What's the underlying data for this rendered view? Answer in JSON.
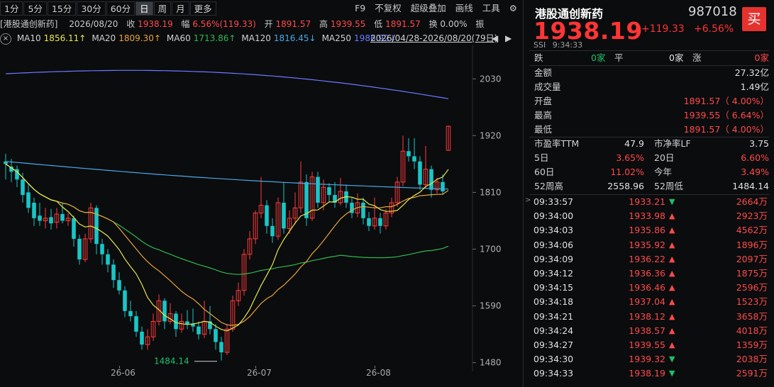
{
  "toolbar": {
    "periods": [
      "1分",
      "5分",
      "15分",
      "30分",
      "60分",
      "日",
      "周",
      "月",
      "更多"
    ],
    "active_index": 5,
    "right_items": [
      "F9",
      "不复权",
      "超级叠加",
      "画线",
      "工具"
    ]
  },
  "infobar": {
    "name": "港股通创新药",
    "date": "2026/08/20",
    "close_label": "收",
    "close_value": "1938.19",
    "range_label": "幅",
    "range_value": "6.56%(119.33)",
    "open_label": "开",
    "open_value": "1891.57",
    "high_label": "高",
    "high_value": "1939.55",
    "low_label": "低",
    "low_value": "1891.57",
    "turnover_label": "换",
    "turnover_value": "0.00%",
    "amp_label": "振"
  },
  "mabar": {
    "items": [
      {
        "label": "MA10",
        "value": "1856.11",
        "arrow": "↑",
        "color": "#e8e84a"
      },
      {
        "label": "MA20",
        "value": "1809.30",
        "arrow": "↑",
        "color": "#e8a43a"
      },
      {
        "label": "MA60",
        "value": "1713.86",
        "arrow": "↑",
        "color": "#2fb84f"
      },
      {
        "label": "MA120",
        "value": "1816.45",
        "arrow": "↓",
        "color": "#4aa8e8"
      },
      {
        "label": "MA250",
        "value": "1986.92",
        "arrow": "↓",
        "color": "#6a7aff"
      }
    ],
    "range": "2026/04/28-2026/08/20(79日)"
  },
  "chart_data": {
    "type": "candlestick",
    "y_ticks": [
      2030,
      1920,
      1810,
      1700,
      1590,
      1480
    ],
    "ylim": [
      1463,
      2095
    ],
    "x_tick_labels": [
      "26-06",
      "26-07",
      "26-08"
    ],
    "low_annotation": "1484.14",
    "candles": [
      [
        1870,
        1865,
        1885,
        1835
      ],
      [
        1860,
        1850,
        1875,
        1830
      ],
      [
        1855,
        1835,
        1862,
        1820
      ],
      [
        1835,
        1805,
        1848,
        1790
      ],
      [
        1810,
        1780,
        1825,
        1770
      ],
      [
        1790,
        1760,
        1800,
        1745
      ],
      [
        1765,
        1755,
        1790,
        1745
      ],
      [
        1755,
        1760,
        1780,
        1740
      ],
      [
        1762,
        1750,
        1778,
        1738
      ],
      [
        1752,
        1768,
        1780,
        1740
      ],
      [
        1768,
        1755,
        1790,
        1750
      ],
      [
        1755,
        1760,
        1770,
        1745
      ],
      [
        1760,
        1720,
        1765,
        1705
      ],
      [
        1720,
        1680,
        1728,
        1670
      ],
      [
        1680,
        1720,
        1730,
        1675
      ],
      [
        1720,
        1780,
        1790,
        1712
      ],
      [
        1780,
        1710,
        1785,
        1690
      ],
      [
        1710,
        1690,
        1720,
        1670
      ],
      [
        1690,
        1670,
        1700,
        1655
      ],
      [
        1670,
        1640,
        1680,
        1625
      ],
      [
        1640,
        1620,
        1655,
        1612
      ],
      [
        1620,
        1580,
        1628,
        1568
      ],
      [
        1580,
        1570,
        1600,
        1560
      ],
      [
        1570,
        1540,
        1580,
        1530
      ],
      [
        1540,
        1515,
        1550,
        1505
      ],
      [
        1515,
        1530,
        1545,
        1505
      ],
      [
        1530,
        1560,
        1575,
        1522
      ],
      [
        1560,
        1600,
        1612,
        1552
      ],
      [
        1600,
        1560,
        1605,
        1545
      ],
      [
        1560,
        1575,
        1595,
        1555
      ],
      [
        1575,
        1545,
        1580,
        1530
      ],
      [
        1545,
        1560,
        1575,
        1538
      ],
      [
        1560,
        1555,
        1582,
        1545
      ],
      [
        1555,
        1550,
        1585,
        1540
      ],
      [
        1550,
        1535,
        1560,
        1525
      ],
      [
        1535,
        1560,
        1600,
        1528
      ],
      [
        1560,
        1545,
        1590,
        1535
      ],
      [
        1545,
        1520,
        1555,
        1505
      ],
      [
        1520,
        1500,
        1530,
        1484
      ],
      [
        1500,
        1545,
        1555,
        1495
      ],
      [
        1545,
        1600,
        1610,
        1540
      ],
      [
        1600,
        1620,
        1635,
        1590
      ],
      [
        1620,
        1690,
        1700,
        1610
      ],
      [
        1690,
        1720,
        1735,
        1680
      ],
      [
        1720,
        1770,
        1775,
        1710
      ],
      [
        1770,
        1785,
        1840,
        1760
      ],
      [
        1785,
        1745,
        1795,
        1730
      ],
      [
        1745,
        1725,
        1760,
        1712
      ],
      [
        1725,
        1790,
        1800,
        1718
      ],
      [
        1790,
        1740,
        1830,
        1730
      ],
      [
        1740,
        1760,
        1775,
        1730
      ],
      [
        1760,
        1780,
        1810,
        1748
      ],
      [
        1780,
        1830,
        1870,
        1770
      ],
      [
        1830,
        1760,
        1845,
        1745
      ],
      [
        1760,
        1840,
        1850,
        1755
      ],
      [
        1840,
        1790,
        1850,
        1780
      ],
      [
        1790,
        1820,
        1835,
        1775
      ],
      [
        1820,
        1805,
        1828,
        1792
      ],
      [
        1805,
        1790,
        1830,
        1780
      ],
      [
        1790,
        1812,
        1838,
        1785
      ],
      [
        1812,
        1790,
        1825,
        1780
      ],
      [
        1790,
        1770,
        1800,
        1760
      ],
      [
        1770,
        1790,
        1808,
        1762
      ],
      [
        1790,
        1760,
        1800,
        1748
      ],
      [
        1760,
        1745,
        1772,
        1735
      ],
      [
        1745,
        1760,
        1800,
        1738
      ],
      [
        1760,
        1745,
        1770,
        1730
      ],
      [
        1745,
        1770,
        1778,
        1738
      ],
      [
        1770,
        1790,
        1800,
        1762
      ],
      [
        1790,
        1830,
        1840,
        1782
      ],
      [
        1830,
        1890,
        1920,
        1822
      ],
      [
        1890,
        1880,
        1915,
        1870
      ],
      [
        1880,
        1870,
        1915,
        1855
      ],
      [
        1870,
        1825,
        1880,
        1815
      ],
      [
        1825,
        1855,
        1900,
        1818
      ],
      [
        1855,
        1815,
        1862,
        1800
      ],
      [
        1815,
        1830,
        1838,
        1808
      ],
      [
        1830,
        1812,
        1845,
        1805
      ],
      [
        1891.57,
        1938.19,
        1939.55,
        1891.57
      ]
    ],
    "ma_series": [
      {
        "name": "MA10",
        "color": "#e8e84a"
      },
      {
        "name": "MA20",
        "color": "#e8a43a"
      },
      {
        "name": "MA60",
        "color": "#2fb84f"
      },
      {
        "name": "MA120",
        "color": "#4aa8e8"
      },
      {
        "name": "MA250",
        "color": "#6a7aff"
      }
    ]
  },
  "quote": {
    "name": "港股通创新药",
    "code": "987018",
    "buy_label": "买",
    "price": "1938.19",
    "change": "+119.33",
    "change_pct": "+6.56%",
    "ssi": "SSI",
    "time": "9:34:33"
  },
  "breadth": {
    "down_label": "跌",
    "down_value": "0家",
    "flat_label": "平",
    "flat_value": "0家",
    "up_label": "涨",
    "up_value": "0家"
  },
  "stats": [
    {
      "label": "金额",
      "value": "27.32亿",
      "color": "#e0e0e0"
    },
    {
      "label": "成交量",
      "value": "1.49亿",
      "color": "#e0e0e0"
    },
    {
      "label": "开盘",
      "value": "1891.57（ 4.00%）",
      "color": "#ff4a4a"
    },
    {
      "label": "最高",
      "value": "1939.55（ 6.64%）",
      "color": "#ff4a4a"
    },
    {
      "label": "最低",
      "value": "1891.57（ 4.00%）",
      "color": "#ff4a4a"
    }
  ],
  "pairs": [
    {
      "l1": "市盈率TTM",
      "v1": "47.9",
      "c1": "#e0e0e0",
      "l2": "市净率LF",
      "v2": "3.75",
      "c2": "#e0e0e0"
    },
    {
      "l1": "5日",
      "v1": "3.65%",
      "c1": "#ff4a4a",
      "l2": "20日",
      "v2": "6.60%",
      "c2": "#ff4a4a"
    },
    {
      "l1": "60日",
      "v1": "11.02%",
      "c1": "#ff4a4a",
      "l2": "今年",
      "v2": "3.49%",
      "c2": "#ff4a4a"
    },
    {
      "l1": "52周高",
      "v1": "2558.96",
      "c1": "#e0e0e0",
      "l2": "52周低",
      "v2": "1484.14",
      "c2": "#e0e0e0"
    }
  ],
  "ticks": [
    {
      "time": "09:33:57",
      "price": "1933.21",
      "dir": "down",
      "vol": "2664万"
    },
    {
      "time": "09:34:00",
      "price": "1933.98",
      "dir": "up",
      "vol": "2923万"
    },
    {
      "time": "09:34:03",
      "price": "1935.86",
      "dir": "up",
      "vol": "4562万"
    },
    {
      "time": "09:34:06",
      "price": "1935.92",
      "dir": "up",
      "vol": "1896万"
    },
    {
      "time": "09:34:09",
      "price": "1936.22",
      "dir": "up",
      "vol": "2097万"
    },
    {
      "time": "09:34:12",
      "price": "1936.36",
      "dir": "up",
      "vol": "1875万"
    },
    {
      "time": "09:34:15",
      "price": "1936.46",
      "dir": "up",
      "vol": "2596万"
    },
    {
      "time": "09:34:18",
      "price": "1937.04",
      "dir": "up",
      "vol": "1523万"
    },
    {
      "time": "09:34:21",
      "price": "1938.12",
      "dir": "up",
      "vol": "3658万"
    },
    {
      "time": "09:34:24",
      "price": "1938.57",
      "dir": "up",
      "vol": "4018万"
    },
    {
      "time": "09:34:27",
      "price": "1939.55",
      "dir": "up",
      "vol": "1359万"
    },
    {
      "time": "09:34:30",
      "price": "1939.32",
      "dir": "down",
      "vol": "2038万"
    },
    {
      "time": "09:34:33",
      "price": "1938.19",
      "dir": "down",
      "vol": "2591万"
    }
  ]
}
